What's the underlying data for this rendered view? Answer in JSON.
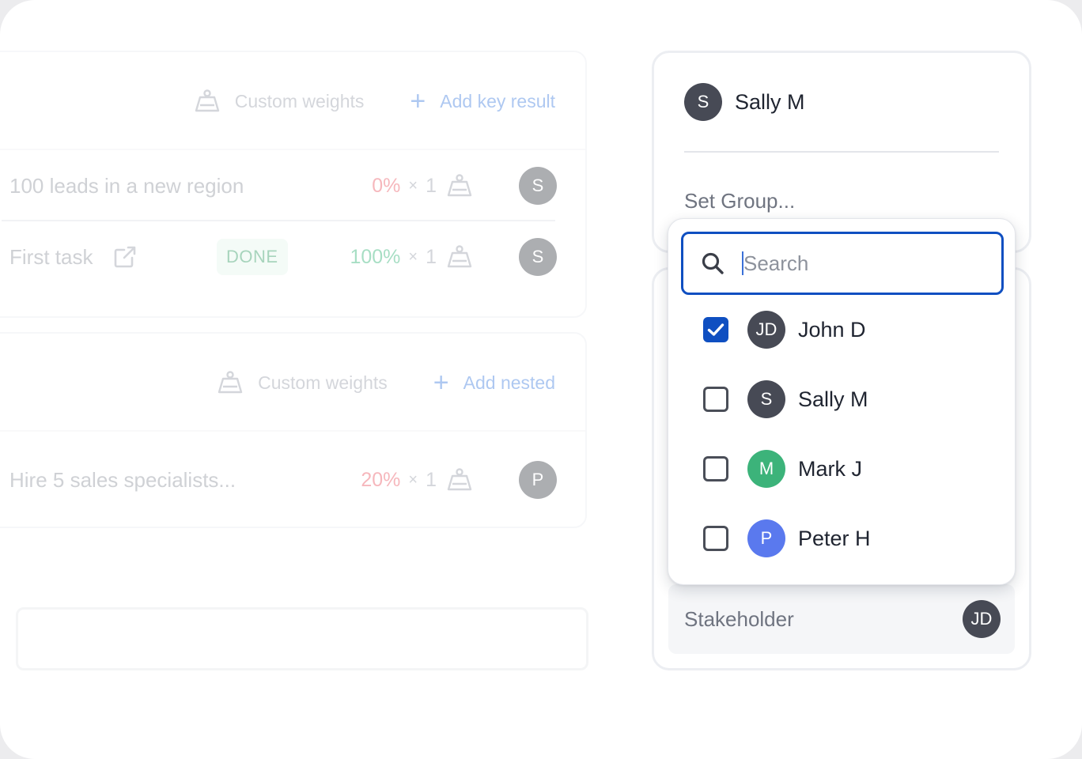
{
  "background": {
    "card1": {
      "custom_weights_label": "Custom weights",
      "add_label": "Add key result",
      "rows": [
        {
          "text": "100 leads in a new region",
          "badge": "",
          "percent": "0%",
          "percent_color": "#ea5562",
          "times": "×",
          "weight": "1",
          "avatar": "S",
          "avatar_color": "#3b3f48"
        },
        {
          "text": "First task",
          "badge": "DONE",
          "percent": "100%",
          "percent_color": "#2fb374",
          "times": "×",
          "weight": "1",
          "avatar": "S",
          "avatar_color": "#3b3f48"
        }
      ]
    },
    "card2": {
      "custom_weights_label": "Custom weights",
      "add_label": "Add nested",
      "rows": [
        {
          "text": "Hire 5 sales specialists...",
          "percent": "20%",
          "percent_color": "#ea5562",
          "times": "×",
          "weight": "1",
          "avatar": "P",
          "avatar_color": "#3b3f48"
        }
      ]
    }
  },
  "owner": {
    "name": "Sally M",
    "initials": "S",
    "avatar_color": "#474a55"
  },
  "set_group_placeholder": "Set Group...",
  "stakeholder": {
    "label": "Stakeholder",
    "initials": "JD",
    "avatar_color": "#474a55"
  },
  "dropdown": {
    "search_placeholder": "Search",
    "accent_color": "#0f4fc1",
    "options": [
      {
        "name": "John D",
        "initials": "JD",
        "avatar_color": "#474a55",
        "checked": true
      },
      {
        "name": "Sally M",
        "initials": "S",
        "avatar_color": "#474a55",
        "checked": false
      },
      {
        "name": "Mark J",
        "initials": "M",
        "avatar_color": "#3cb37a",
        "checked": false
      },
      {
        "name": "Peter H",
        "initials": "P",
        "avatar_color": "#5a79ee",
        "checked": false
      }
    ]
  }
}
